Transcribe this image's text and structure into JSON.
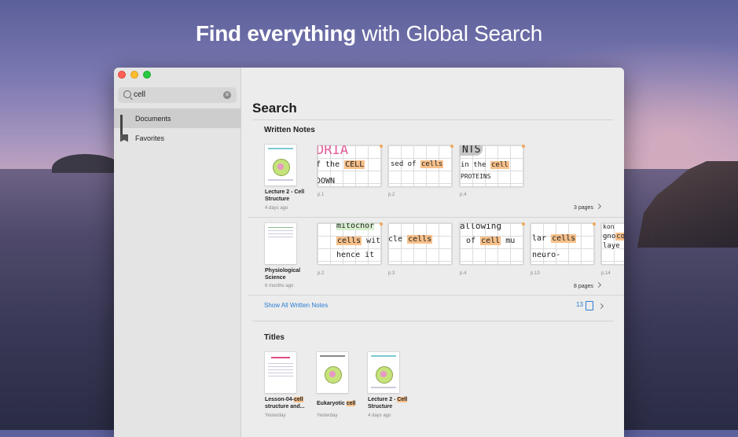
{
  "headline": {
    "bold": "Find everything",
    "rest": " with Global Search"
  },
  "sidebar": {
    "search_value": "cell",
    "items": [
      {
        "label": "Documents",
        "icon": "grid-icon",
        "active": true
      },
      {
        "label": "Favorites",
        "icon": "bookmark-icon",
        "active": false
      }
    ]
  },
  "main": {
    "title": "Search",
    "written_notes": {
      "heading": "Written Notes",
      "groups": [
        {
          "doc_name": "Lecture 2 - Cell Structure",
          "doc_date": "4 days ago",
          "pages": [
            {
              "label": "p.1",
              "ink_top": "DRIA",
              "ink_mid": "f the",
              "hl": "CELL",
              "ink_bot": "DOWN"
            },
            {
              "label": "p.2",
              "ink_mid": "sed of",
              "hl": "cells"
            },
            {
              "label": "p.4",
              "ink_top": "NTS",
              "ink_mid": "in the",
              "hl": "cell",
              "ink_bot": "PROTEINS"
            }
          ],
          "pages_count": "3 pages"
        },
        {
          "doc_name": "Physiological Science",
          "doc_date": "6 months ago",
          "pages": [
            {
              "label": "p.2",
              "ink_top": "mitochor",
              "hl": "cells",
              "ink_mid": "wit",
              "ink_bot": "hence it"
            },
            {
              "label": "p.3",
              "ink_mid": "cle",
              "hl": "cells"
            },
            {
              "label": "p.4",
              "ink_top": "allowing",
              "ink_mid": "of",
              "hl": "cell",
              "ink_after": "mu"
            },
            {
              "label": "p.13",
              "ink_mid": "lar",
              "hl": "cells",
              "ink_bot": "neuro-"
            },
            {
              "label": "p.14",
              "ink_top": "kon",
              "ink_mid": "gno",
              "hl": "co",
              "ink_bot": "laye"
            }
          ],
          "pages_count": "8 pages"
        }
      ],
      "show_all": "Show All Written Notes",
      "count": "13"
    },
    "titles": {
      "heading": "Titles",
      "docs": [
        {
          "name_pre": "Lesson-04-",
          "name_hl": "cell",
          "name_post": " structure and...",
          "date": "Yesterday"
        },
        {
          "name_pre": "Eukaryotic ",
          "name_hl": "cell",
          "name_post": "",
          "date": "Yesterday"
        },
        {
          "name_pre": "Lecture 2 - ",
          "name_hl": "Cell",
          "name_post": " Structure",
          "date": "4 days ago"
        }
      ]
    }
  },
  "colors": {
    "accent": "#2b7cd3",
    "highlight": "#f7c08a",
    "annotation_dot": "#f2a65a"
  }
}
